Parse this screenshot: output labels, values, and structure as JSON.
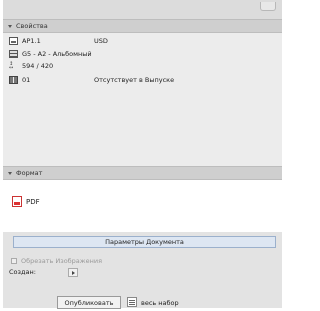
{
  "properties": {
    "header": "Свойства",
    "rows": [
      {
        "icon": "page-icon",
        "name": "AP1.1",
        "value": "USD"
      },
      {
        "icon": "layout-icon",
        "name": "G5 - A2 - Альбомный",
        "value": ""
      },
      {
        "icon": "paper-size-icon",
        "name": "594 / 420",
        "value": ""
      },
      {
        "icon": "book-icon",
        "name": "01",
        "value": "Отсутствует в Выпуске"
      }
    ]
  },
  "format": {
    "header": "Формат",
    "selected": "PDF"
  },
  "document_params_button": "Параметры Документа",
  "trim_images_label": "Обрезать Изображения",
  "create_label": "Создан:",
  "footer": {
    "publish_button": "Опубликовать",
    "set_label": "весь набор"
  }
}
